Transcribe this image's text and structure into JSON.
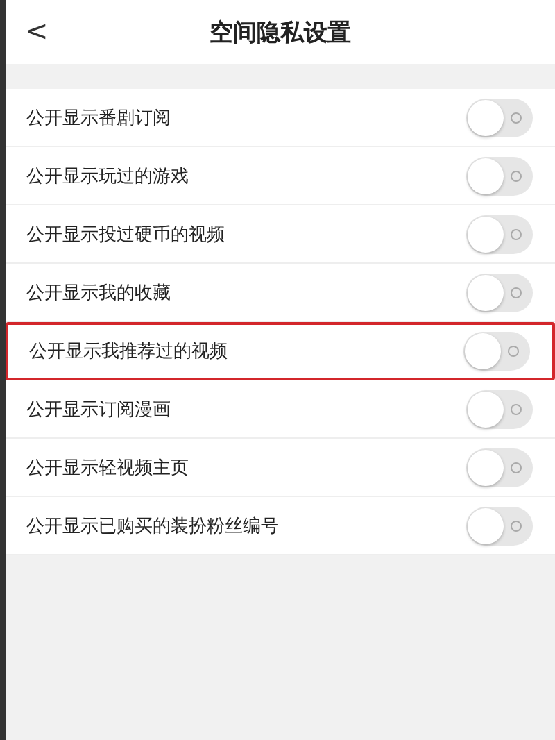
{
  "header": {
    "back": "<",
    "title": "空间隐私设置"
  },
  "settings": [
    {
      "label": "公开显示番剧订阅",
      "on": false,
      "highlighted": false
    },
    {
      "label": "公开显示玩过的游戏",
      "on": false,
      "highlighted": false
    },
    {
      "label": "公开显示投过硬币的视频",
      "on": false,
      "highlighted": false
    },
    {
      "label": "公开显示我的收藏",
      "on": false,
      "highlighted": false
    },
    {
      "label": "公开显示我推荐过的视频",
      "on": false,
      "highlighted": true
    },
    {
      "label": "公开显示订阅漫画",
      "on": false,
      "highlighted": false
    },
    {
      "label": "公开显示轻视频主页",
      "on": false,
      "highlighted": false
    },
    {
      "label": "公开显示已购买的装扮粉丝编号",
      "on": false,
      "highlighted": false
    }
  ]
}
